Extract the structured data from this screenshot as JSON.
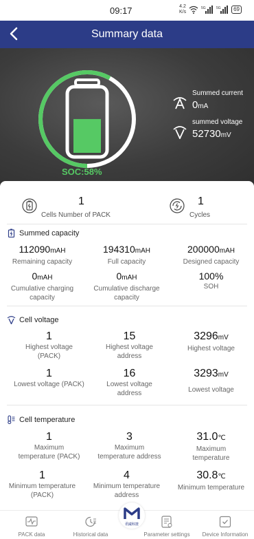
{
  "status_bar": {
    "time": "09:17",
    "speed_value": "4.2",
    "speed_unit": "K/s",
    "battery_level": "69"
  },
  "header": {
    "title": "Summary data"
  },
  "hero": {
    "soc_label": "SOC:58%",
    "soc_percent": 58,
    "summed_current_label": "Summed current",
    "summed_current_value": "0",
    "summed_current_unit": "mA",
    "summed_voltage_label": "summed voltage",
    "summed_voltage_value": "52730",
    "summed_voltage_unit": "mV"
  },
  "top_stats": {
    "cells_number": "1",
    "cells_label": "Cells Number of PACK",
    "cycles": "1",
    "cycles_label": "Cycles"
  },
  "summed_capacity": {
    "title": "Summed capacity",
    "remaining_value": "112090",
    "remaining_unit": "mAH",
    "remaining_label": "Remaining capacity",
    "full_value": "194310",
    "full_unit": "mAH",
    "full_label": "Full capacity",
    "designed_value": "200000",
    "designed_unit": "mAH",
    "designed_label": "Designed capacity",
    "charging_value": "0",
    "charging_unit": "mAH",
    "charging_label_1": "Cumulative charging",
    "charging_label_2": "capacity",
    "discharge_value": "0",
    "discharge_unit": "mAH",
    "discharge_label_1": "Cumulative discharge",
    "discharge_label_2": "capacity",
    "soh_value": "100%",
    "soh_label": "SOH"
  },
  "cell_voltage": {
    "title": "Cell voltage",
    "highest_pack_value": "1",
    "highest_pack_label_1": "Highest voltage",
    "highest_pack_label_2": "(PACK)",
    "highest_address_value": "15",
    "highest_address_label_1": "Highest voltage",
    "highest_address_label_2": "address",
    "highest_value": "3296",
    "highest_unit": "mV",
    "highest_label": "Highest voltage",
    "lowest_pack_value": "1",
    "lowest_pack_label": "Lowest voltage (PACK)",
    "lowest_address_value": "16",
    "lowest_address_label_1": "Lowest voltage",
    "lowest_address_label_2": "address",
    "lowest_value": "3293",
    "lowest_unit": "mV",
    "lowest_label": "Lowest voltage"
  },
  "cell_temperature": {
    "title": "Cell temperature",
    "max_pack_value": "1",
    "max_pack_label_1": "Maximum",
    "max_pack_label_2": "temperature (PACK)",
    "max_address_value": "3",
    "max_address_label_1": "Maximum",
    "max_address_label_2": "temperature address",
    "max_value": "31.0",
    "max_unit": "℃",
    "max_label_1": "Maximum",
    "max_label_2": "temperature",
    "min_pack_value": "1",
    "min_pack_label_1": "Minimum temperature",
    "min_pack_label_2": "(PACK)",
    "min_address_value": "4",
    "min_address_label_1": "Minimum temperature",
    "min_address_label_2": "address",
    "min_value": "30.8",
    "min_unit": "℃",
    "min_label": "Minimum temperature"
  },
  "bottom_nav": {
    "items": [
      {
        "label": "PACK data",
        "icon": "pack-data-icon"
      },
      {
        "label": "Historical data",
        "icon": "history-icon"
      },
      {
        "label": "Parameter settings",
        "icon": "settings-list-icon"
      },
      {
        "label": "Device Information",
        "icon": "device-info-icon"
      }
    ],
    "logo_text": "讯威科技"
  },
  "colors": {
    "header": "#2c3c87",
    "soc_green": "#56c964",
    "hero_bg": "#3c3c3c"
  }
}
